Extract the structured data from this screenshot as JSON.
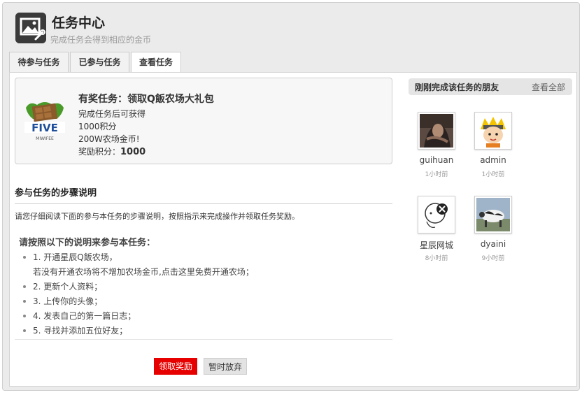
{
  "header": {
    "title": "任务中心",
    "subtitle": "完成任务会得到相应的金币"
  },
  "tabs": [
    {
      "label": "待参与任务"
    },
    {
      "label": "已参与任务"
    },
    {
      "label": "查看任务"
    }
  ],
  "task": {
    "title": "有奖任务：领取Q飯农场大礼包",
    "logo_text": "FIVE",
    "logo_subtext": "MIWIFEE",
    "reward_intro": "完成任务后可获得",
    "reward_points": "1000积分",
    "reward_gold": "200W农场金币!",
    "bonus_label": "奖励积分：",
    "bonus_value": "1000"
  },
  "steps": {
    "title": "参与任务的步骤说明",
    "description": "请您仔细阅读下面的参与本任务的步骤说明，按照指示来完成操作并领取任务奖励。",
    "follow_title": "请按照以下的说明来参与本任务：",
    "items": [
      {
        "text": "1. 开通星辰Q飯农场，",
        "sub": "若没有开通农场将不增加农场金币,点击这里免费开通农场；"
      },
      {
        "text": "2. 更新个人资料；"
      },
      {
        "text": "3. 上传你的头像；"
      },
      {
        "text": "4. 发表自己的第一篇日志；"
      },
      {
        "text": "5. 寻找并添加五位好友；"
      }
    ]
  },
  "buttons": {
    "claim": "领取奖励",
    "giveup": "暂时放弃"
  },
  "friends": {
    "title": "刚刚完成该任务的朋友",
    "view_all": "查看全部",
    "list": [
      {
        "name": "guihuan",
        "time": "1小时前",
        "avatar": "photo-avatar"
      },
      {
        "name": "admin",
        "time": "1小时前",
        "avatar": "cartoon-avatar"
      },
      {
        "name": "星辰网城",
        "time": "8小时前",
        "avatar": "sketch-avatar"
      },
      {
        "name": "dyaini",
        "time": "9小时前",
        "avatar": "cow-avatar"
      }
    ]
  },
  "colors": {
    "claim_button": "#e60000",
    "page_background": "#ebebeb"
  }
}
